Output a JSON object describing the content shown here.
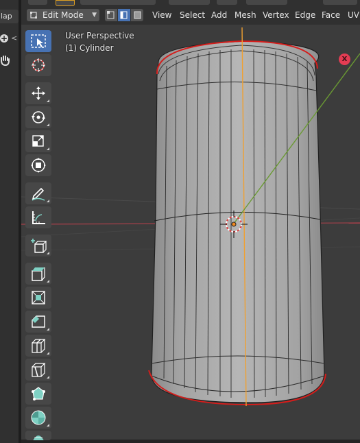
{
  "side_panel": {
    "tab_label": "lap",
    "plus_symbol": "+",
    "chevron": "<"
  },
  "header": {
    "mode_label": "Edit Mode",
    "menus": [
      "View",
      "Select",
      "Add",
      "Mesh",
      "Vertex",
      "Edge",
      "Face",
      "UV"
    ],
    "select_mode_active": "edge"
  },
  "viewport": {
    "perspective_label": "User Perspective",
    "object_label": "(1) Cylinder",
    "gizmo_x_label": "X"
  },
  "toolbar": {
    "tools": [
      {
        "name": "select-box-tool",
        "icon": "select-box-icon",
        "active": true
      },
      {
        "name": "cursor-tool",
        "icon": "cursor-icon",
        "active": false
      },
      {
        "name": "move-tool",
        "icon": "move-icon",
        "active": false
      },
      {
        "name": "rotate-tool",
        "icon": "rotate-icon",
        "active": false
      },
      {
        "name": "scale-tool",
        "icon": "scale-icon",
        "active": false
      },
      {
        "name": "transform-tool",
        "icon": "transform-icon",
        "active": false
      },
      {
        "name": "annotate-tool",
        "icon": "annotate-icon",
        "active": false
      },
      {
        "name": "measure-tool",
        "icon": "measure-icon",
        "active": false
      },
      {
        "name": "add-cube-tool",
        "icon": "add-cube-icon",
        "active": false
      },
      {
        "name": "extrude-tool",
        "icon": "extrude-icon",
        "active": false
      },
      {
        "name": "inset-tool",
        "icon": "inset-icon",
        "active": false
      },
      {
        "name": "bevel-tool",
        "icon": "bevel-icon",
        "active": false
      },
      {
        "name": "loop-cut-tool",
        "icon": "loop-cut-icon",
        "active": false
      },
      {
        "name": "knife-tool",
        "icon": "knife-icon",
        "active": false
      },
      {
        "name": "poly-build-tool",
        "icon": "poly-build-icon",
        "active": false
      },
      {
        "name": "spin-tool",
        "icon": "spin-icon",
        "active": false
      },
      {
        "name": "smooth-tool",
        "icon": "smooth-icon",
        "active": false
      }
    ]
  },
  "colors": {
    "background": "#3c3c3c",
    "header": "#303030",
    "accent": "#4772b3",
    "x_axis": "#b33c4a",
    "y_axis": "#6a9a33",
    "z_axis": "#f2a23a",
    "selection_edge": "#e0201e"
  }
}
